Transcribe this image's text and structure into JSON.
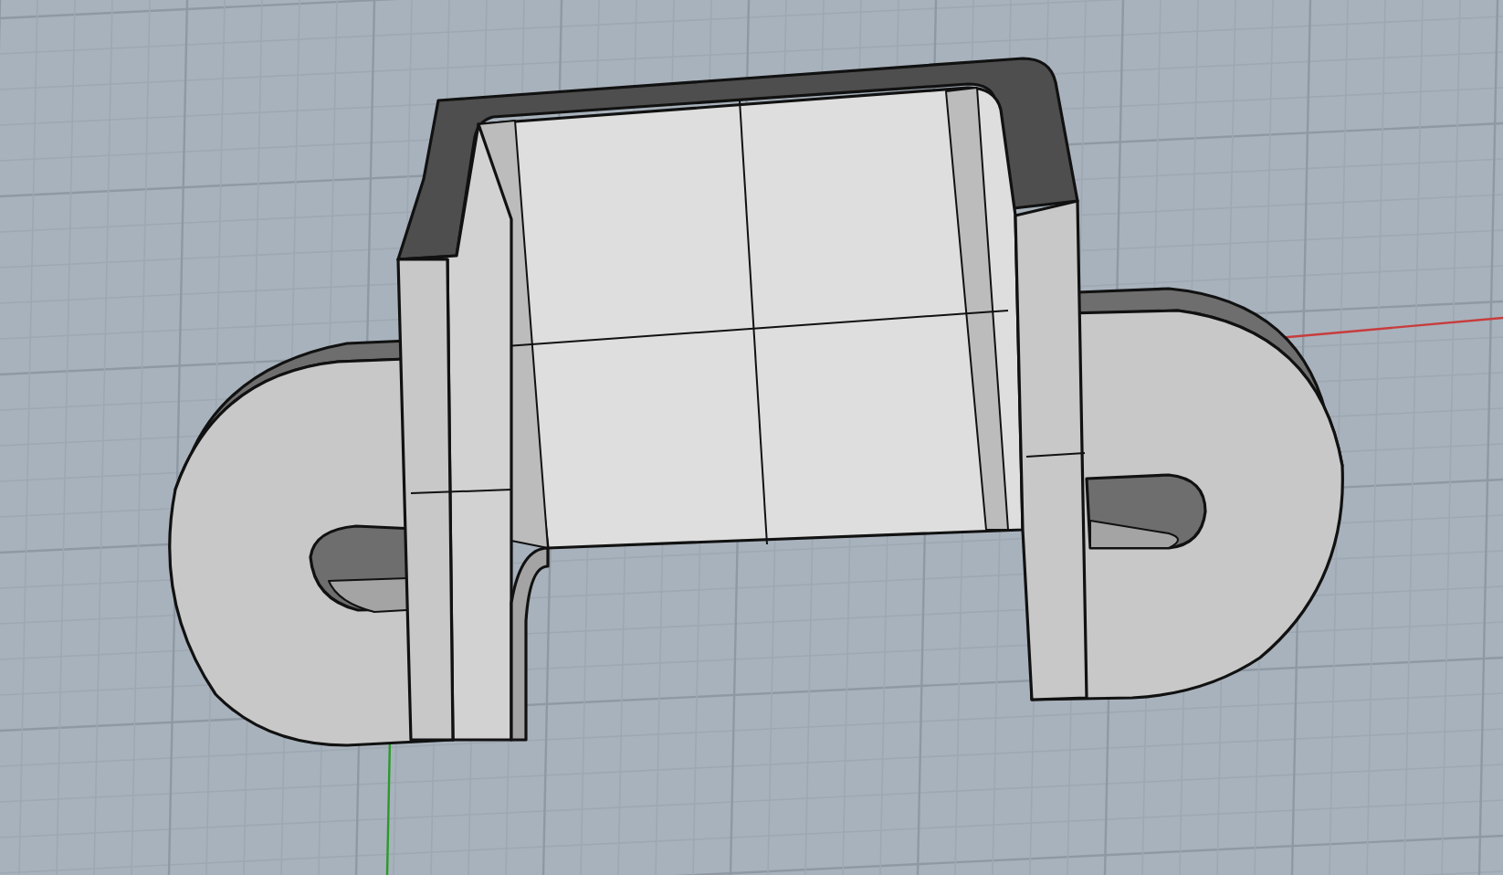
{
  "viewport": {
    "axes": [
      {
        "kind": "x",
        "color": "#c83c3c"
      },
      {
        "kind": "y",
        "color": "#2a9a2a"
      }
    ]
  }
}
